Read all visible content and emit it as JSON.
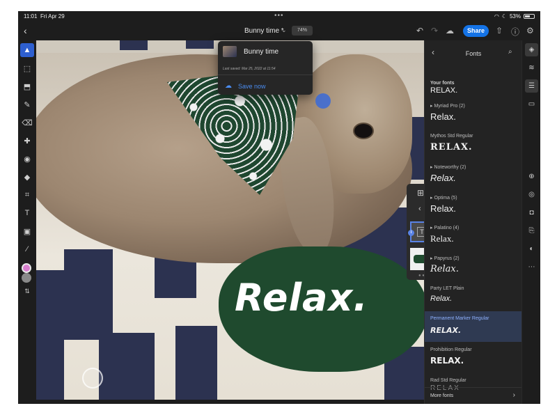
{
  "status_bar": {
    "time": "11:01",
    "date": "Fri Apr 29",
    "multitask_dots": "•••",
    "battery": "53%"
  },
  "topbar": {
    "back": "‹",
    "title": "Bunny time *",
    "title_chevron": "⌄",
    "zoom": "74%",
    "share_label": "Share"
  },
  "save_popover": {
    "title": "Bunny time",
    "last_saved": "Last saved: Mar 25, 2022 at 11:54",
    "save_now": "Save now"
  },
  "canvas": {
    "text_layer": "Relax."
  },
  "fonts_panel": {
    "title": "Fonts",
    "section": "Your fonts",
    "items": [
      {
        "name": "",
        "sample": "RELAX."
      },
      {
        "name": "▸ Myriad Pro (2)",
        "sample": "Relax."
      },
      {
        "name": "Mythos Std Regular",
        "sample": "RELAX."
      },
      {
        "name": "▸ Noteworthy (2)",
        "sample": "Relax."
      },
      {
        "name": "▸ Optima (5)",
        "sample": "Relax."
      },
      {
        "name": "▸ Palatino (4)",
        "sample": "Relax."
      },
      {
        "name": "▸ Papyrus (2)",
        "sample": "Relax."
      },
      {
        "name": "Party LET Plain",
        "sample": "Relax."
      },
      {
        "name": "Permanent Marker Regular",
        "sample": "RELAX."
      },
      {
        "name": "Prohibition Regular",
        "sample": "RELAX."
      },
      {
        "name": "Rad Std Regular",
        "sample": "RELAX"
      }
    ],
    "selected_index": 8,
    "more_fonts": "More fonts",
    "more_chevron": "›"
  },
  "colors": {
    "accent": "#1473e6",
    "primary_swatch": "#d97fcf",
    "secondary_swatch": "#8a8a8a",
    "paint": "#1f4a2e"
  }
}
